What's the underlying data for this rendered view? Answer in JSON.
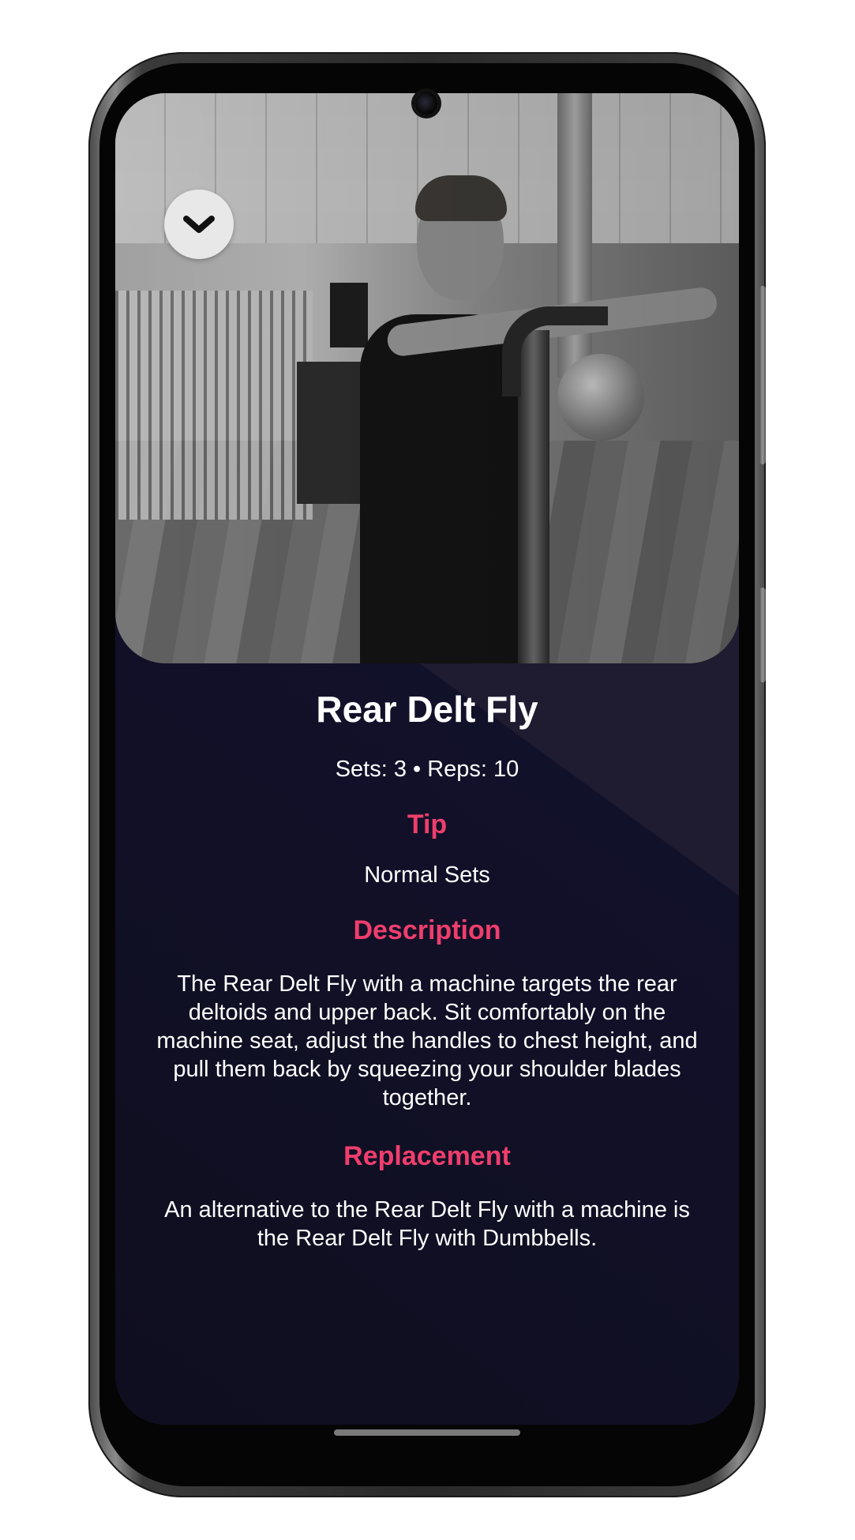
{
  "exercise": {
    "title": "Rear Delt Fly",
    "sets_reps": "Sets: 3 • Reps: 10"
  },
  "tip": {
    "heading": "Tip",
    "text": "Normal Sets"
  },
  "description": {
    "heading": "Description",
    "text": "The Rear Delt Fly with a machine targets the rear deltoids and upper back. Sit comfortably on the machine seat, adjust the handles to chest height, and pull them back by squeezing your shoulder blades together."
  },
  "replacement": {
    "heading": "Replacement",
    "text": "An alternative to the Rear Delt Fly with a machine is the Rear Delt Fly with Dumbbells."
  },
  "hero_image": {
    "icon": "exercise-photo"
  },
  "controls": {
    "collapse_icon": "chevron-down-icon"
  },
  "colors": {
    "accent": "#ef3e6d",
    "background": "#1f1b30",
    "text": "#ffffff",
    "collapse_button_bg": "#e8e8e8"
  }
}
